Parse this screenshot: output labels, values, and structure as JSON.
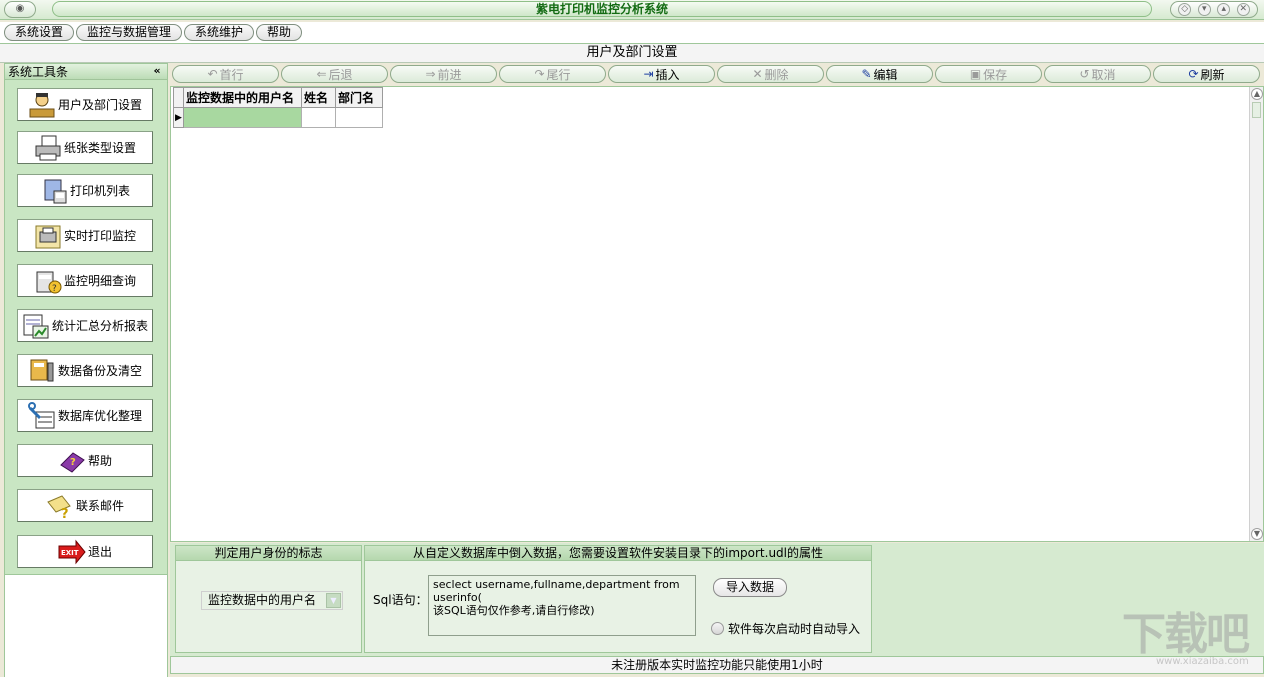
{
  "window": {
    "title": "紫电打印机监控分析系统"
  },
  "menu": [
    "系统设置",
    "监控与数据管理",
    "系统维护",
    "帮助"
  ],
  "page": {
    "title": "用户及部门设置"
  },
  "sidebar": {
    "title": "系统工具条",
    "collapse_glyph": "«",
    "items": [
      {
        "label": "用户及部门设置",
        "icon": "user-desk-icon"
      },
      {
        "label": "纸张类型设置",
        "icon": "printer-paper-icon"
      },
      {
        "label": "打印机列表",
        "icon": "printer-icon"
      },
      {
        "label": "实时打印监控",
        "icon": "printer-monitor-icon"
      },
      {
        "label": "监控明细查询",
        "icon": "calculator-query-icon"
      },
      {
        "label": "统计汇总分析报表",
        "icon": "report-chart-icon"
      },
      {
        "label": "数据备份及清空",
        "icon": "backup-icon"
      },
      {
        "label": "数据库优化整理",
        "icon": "database-tool-icon"
      },
      {
        "label": "帮助",
        "icon": "help-book-icon"
      },
      {
        "label": "联系邮件",
        "icon": "mail-icon"
      },
      {
        "label": "退出",
        "icon": "exit-icon"
      }
    ]
  },
  "toolbar": {
    "buttons": [
      {
        "label": "首行",
        "glyph": "↶",
        "enabled": false
      },
      {
        "label": "后退",
        "glyph": "⇐",
        "enabled": false
      },
      {
        "label": "前进",
        "glyph": "⇒",
        "enabled": false
      },
      {
        "label": "尾行",
        "glyph": "↷",
        "enabled": false
      },
      {
        "label": "插入",
        "glyph": "⇥",
        "enabled": true
      },
      {
        "label": "删除",
        "glyph": "✕",
        "enabled": false
      },
      {
        "label": "编辑",
        "glyph": "✎",
        "enabled": true
      },
      {
        "label": "保存",
        "glyph": "▣",
        "enabled": false
      },
      {
        "label": "取消",
        "glyph": "↺",
        "enabled": false
      },
      {
        "label": "刷新",
        "glyph": "⟳",
        "enabled": true
      }
    ]
  },
  "grid": {
    "columns": [
      "监控数据中的用户名",
      "姓名",
      "部门名"
    ],
    "rows": [
      [
        "",
        "",
        ""
      ]
    ],
    "row_indicator": "▶"
  },
  "identity_group": {
    "title": "判定用户身份的标志",
    "selected": "监控数据中的用户名"
  },
  "import_group": {
    "title": "从自定义数据库中倒入数据，您需要设置软件安装目录下的import.udl的属性",
    "sql_label": "Sql语句：",
    "sql_text": "seclect username,fullname,department from userinfo(\n该SQL语句仅作参考,请自行修改)",
    "import_button": "导入数据",
    "auto_import_label": "软件每次启动时自动导入",
    "auto_import_checked": false
  },
  "status": {
    "text": "未注册版本实时监控功能只能使用1小时"
  },
  "watermark": {
    "big": "下载吧",
    "small": "www.xiazaiba.com"
  }
}
